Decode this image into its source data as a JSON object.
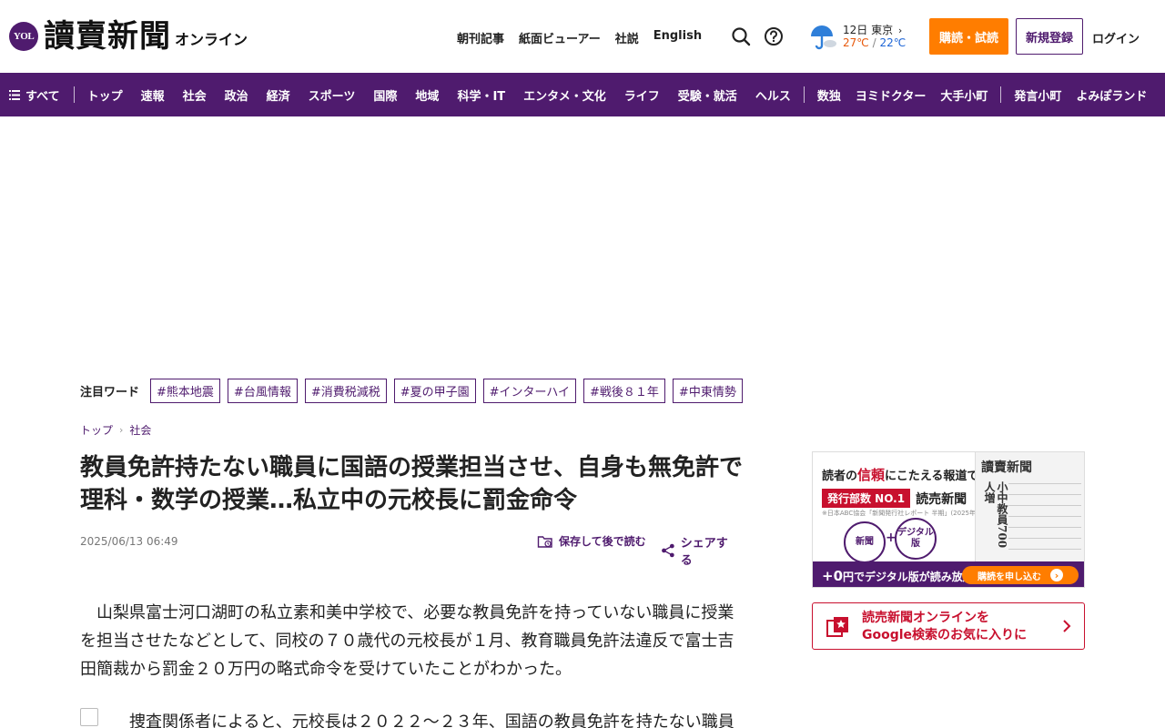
{
  "header": {
    "logo_badge": "YOL",
    "logo_name": "讀賣新聞",
    "logo_sub": "オンライン",
    "links": [
      "朝刊記事",
      "紙面ビューアー",
      "社説",
      "English"
    ],
    "search_icon": "search-icon",
    "help_icon": "help-icon",
    "weather": {
      "date_city": "12日 東京",
      "high": "27℃",
      "separator": "/",
      "low": "22℃",
      "icon": "rain-umbrella-icon"
    },
    "subscribe_label": "購読・試読",
    "register_label": "新規登録",
    "login_label": "ログイン"
  },
  "nav": {
    "all_label": "すべて",
    "group1": [
      "トップ",
      "速報",
      "社会",
      "政治",
      "経済",
      "スポーツ",
      "国際",
      "地域",
      "科学・IT",
      "エンタメ・文化",
      "ライフ",
      "受験・就活",
      "ヘルス"
    ],
    "group2": [
      "数独",
      "ヨミドクター",
      "大手小町"
    ],
    "group3": [
      "発言小町",
      "よみぽランド"
    ]
  },
  "trending": {
    "label": "注目ワード",
    "tags": [
      "#熊本地震",
      "#台風情報",
      "#消費税減税",
      "#夏の甲子園",
      "#インターハイ",
      "#戦後８１年",
      "#中東情勢"
    ]
  },
  "breadcrumb": {
    "items": [
      "トップ",
      "社会"
    ]
  },
  "article": {
    "title": "教員免許持たない職員に国語の授業担当させ、自身も無免許で理科・数学の授業…私立中の元校長に罰金命令",
    "date": "2025/06/13 06:49",
    "save_label": "保存して後で読む",
    "share_label": "シェアする",
    "paragraph1": "山梨県富士河口湖町の私立素和美中学校で、必要な教員免許を持っていない職員に授業を担当させたなどとして、同校の７０歳代の元校長が１月、教育職員免許法違反で富士吉田簡裁から罰金２０万円の略式命令を受けていたことがわかった。",
    "paragraph2": "捜査関係者によると、元校長は２０２２～２３年、国語の教員免許を持たない職員"
  },
  "sidebar": {
    "ad": {
      "lead_pre": "読者の",
      "lead_emph": "信頼",
      "lead_post": "にこたえる報道で",
      "pill": "発行部数 NO.1",
      "brand": "読売新聞",
      "note": "※日本ABC協会「新聞発行社レポート 半期」(2025年1月～12月平均)より",
      "circle_news": "新聞",
      "circle_plus": "+",
      "circle_digital": "デジタル版",
      "paper_title": "讀賣新聞",
      "paper_headline": "小中教員700人増",
      "band_text_pre": "+0",
      "band_text_post": "円でデジタル版が読み放題!",
      "band_button": "購読を申し込む"
    },
    "google_box": {
      "line1": "読売新聞オンラインを",
      "line2": "Google検索のお気に入りに"
    }
  },
  "colors": {
    "brand_purple": "#4f1b6e",
    "accent_orange": "#ff7d00",
    "accent_red": "#c8102e"
  }
}
